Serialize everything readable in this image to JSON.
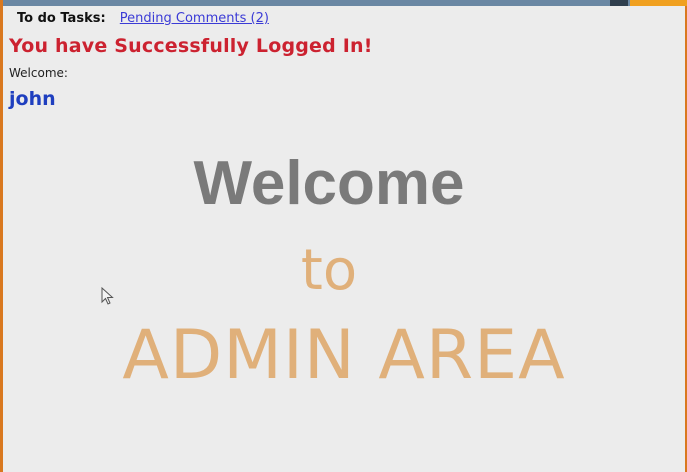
{
  "header": {
    "todo_label": "To do Tasks:",
    "pending_link": "Pending Comments (2)"
  },
  "messages": {
    "success": "You have Successfully Logged In!",
    "welcome_label": "Welcome:",
    "username": "john"
  },
  "banner": {
    "line1": "Welcome",
    "line2": "to",
    "line3": "ADMIN AREA"
  },
  "colors": {
    "frame_border": "#d9781f",
    "success_text": "#cc2230",
    "username_text": "#1f3fbf",
    "welcome_gray": "#7a7a7a",
    "banner_tan": "#e0b07a",
    "background": "#ececec"
  },
  "icons": {
    "cursor": "mouse-pointer-icon"
  }
}
